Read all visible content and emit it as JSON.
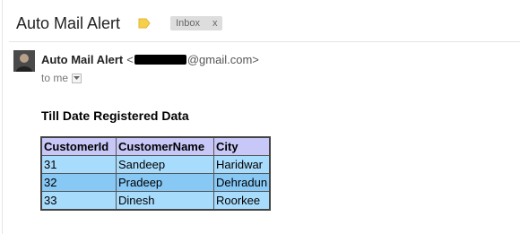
{
  "header": {
    "subject": "Auto Mail Alert",
    "label_chip": "Inbox",
    "label_chip_close": "x"
  },
  "sender": {
    "name": "Auto Mail Alert",
    "address_open": "<",
    "address_domain": "@gmail.com>",
    "to_text": "to me"
  },
  "email_body": {
    "heading": "Till Date Registered Data",
    "table": {
      "headers": [
        "CustomerId",
        "CustomerName",
        "City"
      ],
      "rows": [
        [
          "31",
          "Sandeep",
          "Haridwar"
        ],
        [
          "32",
          "Pradeep",
          "Dehradun"
        ],
        [
          "33",
          "Dinesh",
          "Roorkee"
        ]
      ]
    }
  },
  "colors": {
    "important_marker": "#f7d04a",
    "table_header_bg": "#c8c8f8",
    "table_row_light": "#a8dcfc",
    "table_row_dark": "#87c8f5"
  },
  "icons": {
    "importance": "importance-marker-icon",
    "details_dropdown": "chevron-down-icon"
  }
}
